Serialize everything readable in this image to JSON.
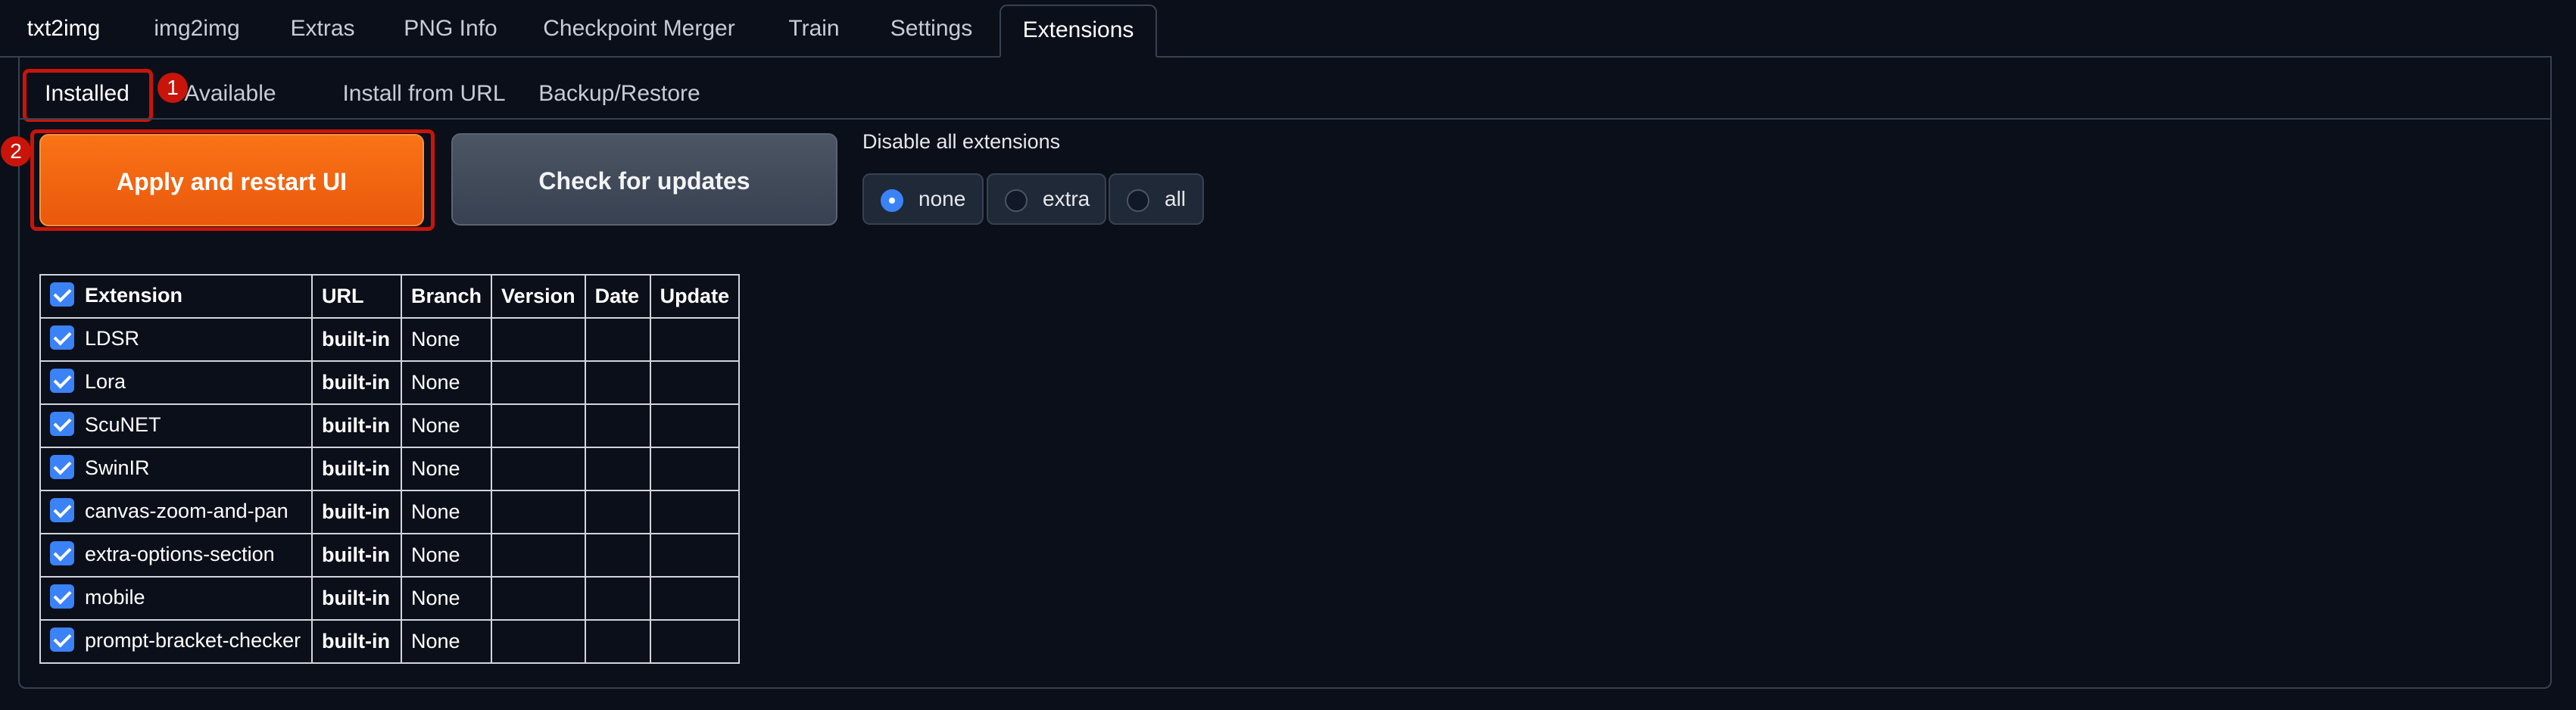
{
  "top_tabs": [
    {
      "label": "txt2img"
    },
    {
      "label": "img2img"
    },
    {
      "label": "Extras"
    },
    {
      "label": "PNG Info"
    },
    {
      "label": "Checkpoint Merger"
    },
    {
      "label": "Train"
    },
    {
      "label": "Settings"
    },
    {
      "label": "Extensions"
    }
  ],
  "active_top_tab": "Extensions",
  "sub_tabs": [
    {
      "label": "Installed"
    },
    {
      "label": "Available"
    },
    {
      "label": "Install from URL"
    },
    {
      "label": "Backup/Restore"
    }
  ],
  "active_sub_tab": "Installed",
  "annotations": {
    "badge1": "1",
    "badge2": "2"
  },
  "buttons": {
    "apply_restart": "Apply and restart UI",
    "check_updates": "Check for updates"
  },
  "disable_extensions": {
    "label": "Disable all extensions",
    "options": [
      "none",
      "extra",
      "all"
    ],
    "selected": "none"
  },
  "table": {
    "headers": [
      "Extension",
      "URL",
      "Branch",
      "Version",
      "Date",
      "Update"
    ],
    "rows": [
      {
        "name": "LDSR",
        "url": "built-in",
        "branch": "None",
        "version": "",
        "date": "",
        "update": "",
        "checked": true
      },
      {
        "name": "Lora",
        "url": "built-in",
        "branch": "None",
        "version": "",
        "date": "",
        "update": "",
        "checked": true
      },
      {
        "name": "ScuNET",
        "url": "built-in",
        "branch": "None",
        "version": "",
        "date": "",
        "update": "",
        "checked": true
      },
      {
        "name": "SwinIR",
        "url": "built-in",
        "branch": "None",
        "version": "",
        "date": "",
        "update": "",
        "checked": true
      },
      {
        "name": "canvas-zoom-and-pan",
        "url": "built-in",
        "branch": "None",
        "version": "",
        "date": "",
        "update": "",
        "checked": true
      },
      {
        "name": "extra-options-section",
        "url": "built-in",
        "branch": "None",
        "version": "",
        "date": "",
        "update": "",
        "checked": true
      },
      {
        "name": "mobile",
        "url": "built-in",
        "branch": "None",
        "version": "",
        "date": "",
        "update": "",
        "checked": true
      },
      {
        "name": "prompt-bracket-checker",
        "url": "built-in",
        "branch": "None",
        "version": "",
        "date": "",
        "update": "",
        "checked": true
      }
    ]
  },
  "colors": {
    "background": "#0b0f19",
    "primary_button": "#f97316",
    "secondary_button": "#4b5563",
    "annotation_red": "#c9140a",
    "checkbox_blue": "#3b82f6"
  }
}
